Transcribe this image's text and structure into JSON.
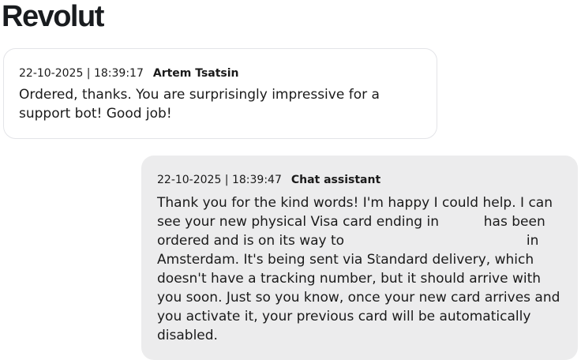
{
  "brand": {
    "logo_text": "Revolut"
  },
  "messages": [
    {
      "role": "user",
      "timestamp": "22-10-2025 | 18:39:17",
      "author": "Artem Tsatsin",
      "text": "Ordered, thanks. You are surprisingly impressive for a support bot! Good job!"
    },
    {
      "role": "assistant",
      "timestamp": "22-10-2025 | 18:39:47",
      "author": "Chat assistant",
      "text_part1": "Thank you for the kind words! I'm happy I could help. I can see your new physical Visa card ending in",
      "text_part2": "has been ordered and is on its way to",
      "text_part3": "in Amsterdam. It's being sent via Standard delivery, which doesn't have a tracking number, but it should arrive with you soon. Just so you know, once your new card arrives and you activate it, your previous card will be automatically disabled."
    }
  ]
}
